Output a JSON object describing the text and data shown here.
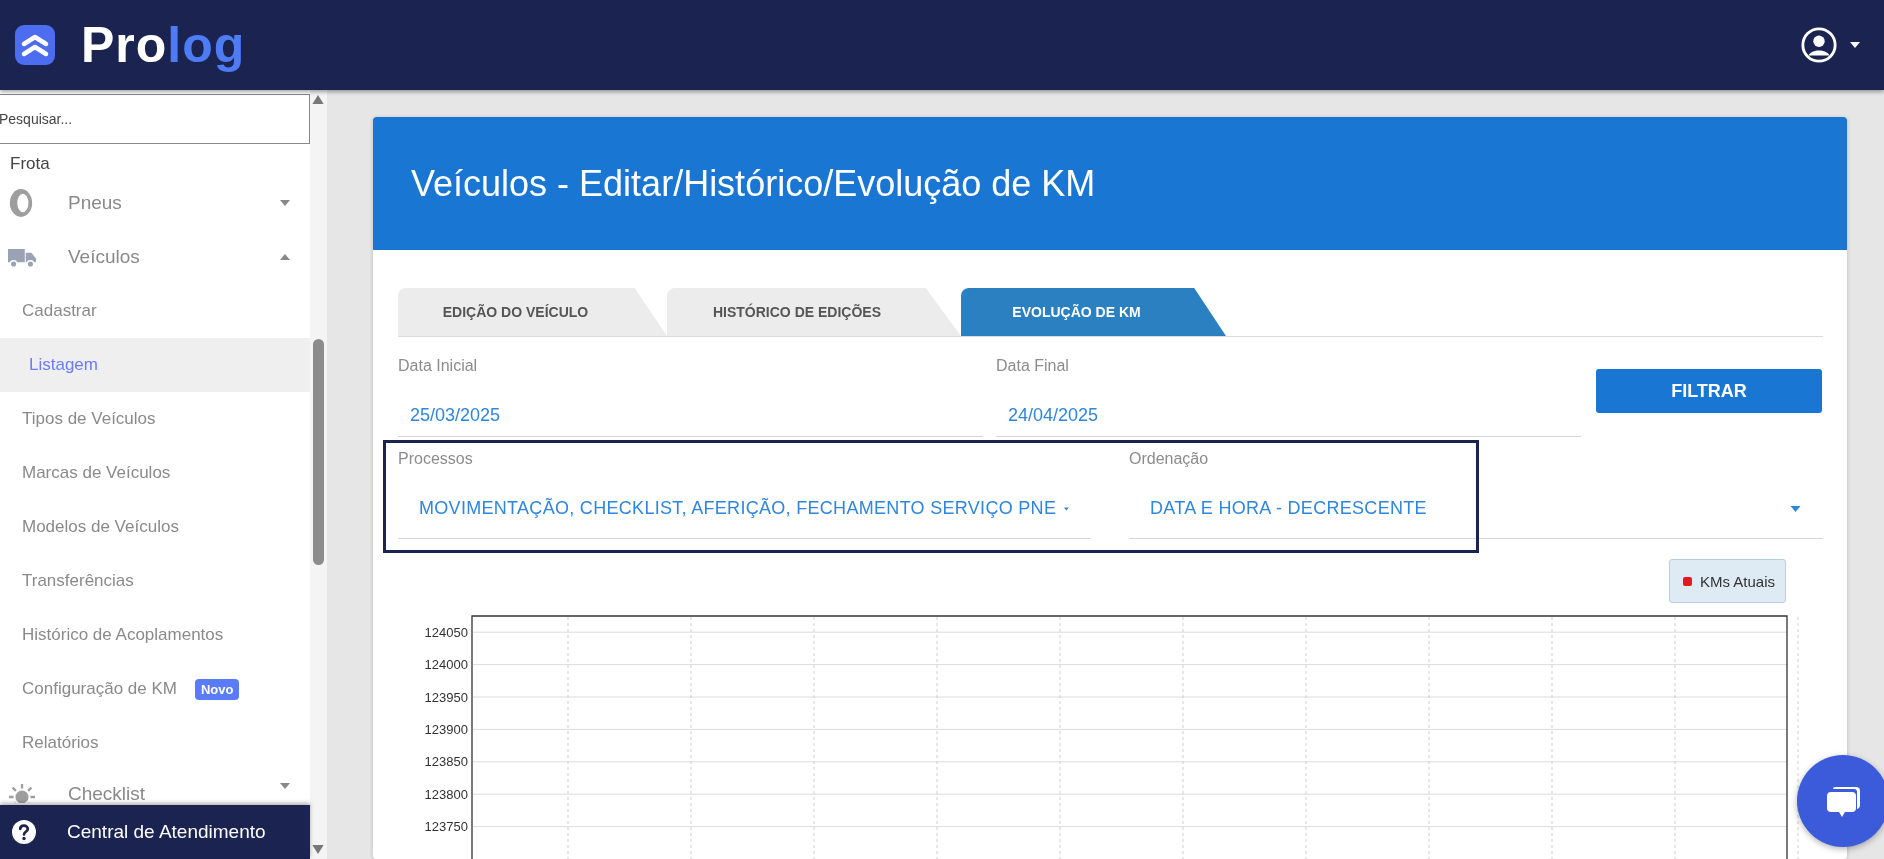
{
  "header": {
    "logo": {
      "primary": "Pro",
      "accent": "log"
    }
  },
  "sidebar": {
    "search": {
      "placeholder": "Pesquisar..."
    },
    "section": "Frota",
    "groups": [
      {
        "label": "Pneus",
        "expanded": false
      },
      {
        "label": "Veículos",
        "expanded": true,
        "children": [
          {
            "label": "Cadastrar",
            "selected": false
          },
          {
            "label": "Listagem",
            "selected": true
          },
          {
            "label": "Tipos de Veículos",
            "selected": false
          },
          {
            "label": "Marcas de Veículos",
            "selected": false
          },
          {
            "label": "Modelos de Veículos",
            "selected": false
          },
          {
            "label": "Transferências",
            "selected": false
          },
          {
            "label": "Histórico de Acoplamentos",
            "selected": false
          },
          {
            "label": "Configuração de KM",
            "selected": false,
            "badge": "Novo"
          },
          {
            "label": "Relatórios",
            "selected": false
          }
        ]
      },
      {
        "label": "Checklist",
        "expanded": false
      }
    ],
    "help_button": {
      "label": "Central de Atendimento"
    }
  },
  "card": {
    "title": "Veículos - Editar/Histórico/Evolução de KM",
    "tabs": [
      {
        "label": "EDIÇÃO DO VEÍCULO",
        "selected": false
      },
      {
        "label": "HISTÓRICO DE EDIÇÕES",
        "selected": false
      },
      {
        "label": "EVOLUÇÃO DE KM",
        "selected": true
      }
    ],
    "date_fields": [
      {
        "label": "Data Inicial",
        "value": "25/03/2025"
      },
      {
        "label": "Data Final",
        "value": "24/04/2025"
      }
    ],
    "filter_button": "FILTRAR",
    "select_fields": [
      {
        "label": "Processos",
        "value": "MOVIMENTAÇÃO, CHECKLIST, AFERIÇÃO, FECHAMENTO SERVIÇO PNE"
      },
      {
        "label": "Ordenação",
        "value": "DATA E HORA - DECRESCENTE"
      }
    ],
    "chart": {
      "chart_data": {
        "type": "line",
        "series": [
          {
            "name": "KMs Atuais",
            "color": "#e31a1c"
          }
        ],
        "ylim": [
          123700,
          124075
        ],
        "yticks": [
          123750,
          123800,
          123850,
          123900,
          123950,
          124000,
          124050
        ],
        "grid": true
      }
    }
  }
}
